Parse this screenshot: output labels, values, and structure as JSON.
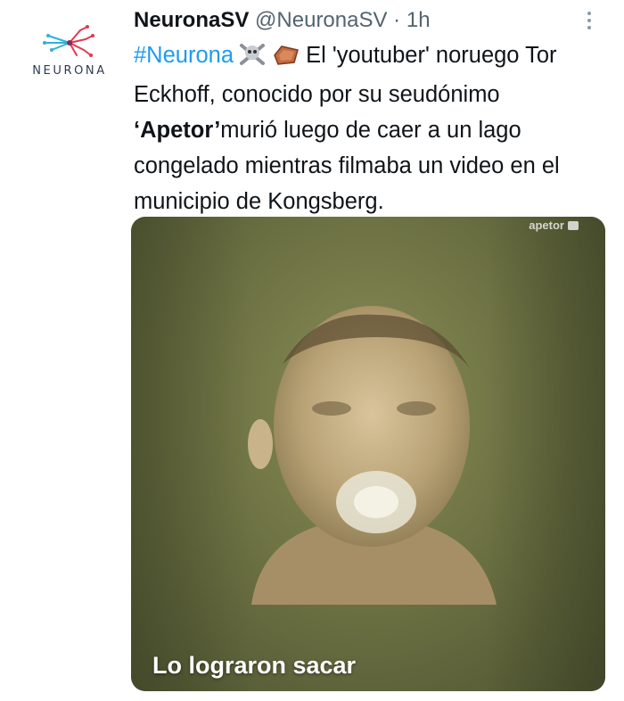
{
  "author": {
    "logo_text": "NEURONA",
    "display_name": "NeuronaSV",
    "handle": "@NeuronaSV",
    "separator": "·",
    "time": "1h"
  },
  "tweet": {
    "hashtag": "#Neurona",
    "emojis": [
      "skull-and-crossbones-icon",
      "coffin-icon"
    ],
    "text_1": " El 'youtuber' noruego Tor Eckhoff, conocido por su seudónimo ",
    "bold_name": "‘Apetor’",
    "text_2": "murió luego de caer a un lago congelado mientras filmaba un video en el municipio de Kongsberg."
  },
  "media": {
    "watermark": "apetor",
    "caption": "Lo lograron sacar"
  },
  "colors": {
    "link": "#1d9bf0",
    "text": "#0f1419",
    "secondary": "#536471"
  }
}
